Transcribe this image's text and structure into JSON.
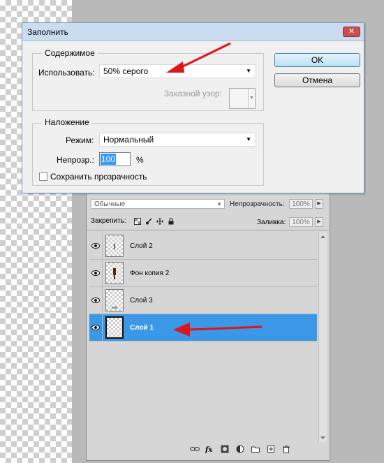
{
  "dialog": {
    "title": "Заполнить",
    "close_label": "✕",
    "contents": {
      "legend": "Содержимое",
      "use_label": "Использовать:",
      "use_value": "50% серого",
      "pattern_label": "Заказной узор:"
    },
    "blending": {
      "legend": "Наложение",
      "mode_label": "Режим:",
      "mode_value": "Нормальный",
      "opacity_label": "Непрозр.:",
      "opacity_value": "100",
      "opacity_unit": "%",
      "preserve_label": "Сохранить прозрачность",
      "preserve_checked": false
    },
    "ok_label": "OK",
    "cancel_label": "Отмена"
  },
  "layers_panel": {
    "blend_mode": "Обычные",
    "opacity_label": "Непрозрачность:",
    "opacity_value": "100%",
    "lock_label": "Закрепить:",
    "fill_label": "Заливка:",
    "fill_value": "100%",
    "layers": [
      {
        "name": "Слой 2",
        "visible": true,
        "selected": false
      },
      {
        "name": "Фон копия 2",
        "visible": true,
        "selected": false
      },
      {
        "name": "Слой 3",
        "visible": true,
        "selected": false
      },
      {
        "name": "Слой 1",
        "visible": true,
        "selected": true
      }
    ],
    "bottom_icons": [
      "link-icon",
      "fx-icon",
      "mask-icon",
      "adjustment-icon",
      "folder-icon",
      "new-layer-icon",
      "trash-icon"
    ]
  },
  "colors": {
    "selection": "#3b98e6",
    "arrow": "#e0141c"
  }
}
